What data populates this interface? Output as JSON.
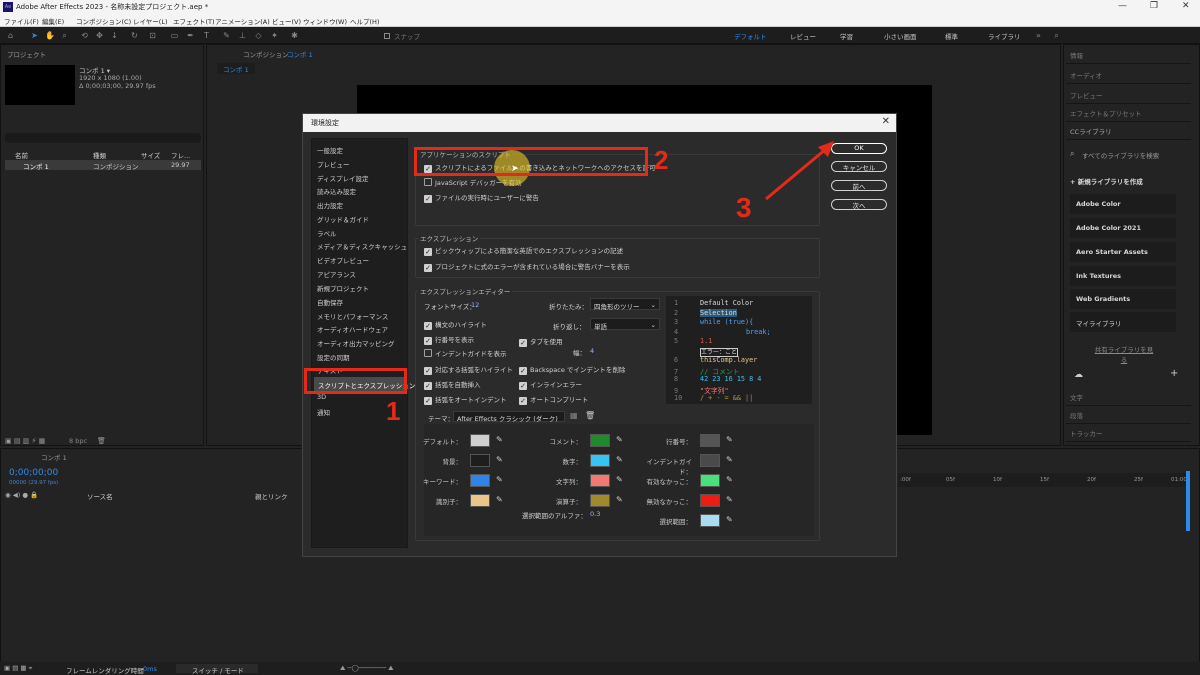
{
  "app": {
    "logo": "Ae",
    "title": "Adobe After Effects 2023 - 名称未設定プロジェクト.aep *",
    "menu": [
      "ファイル(F)",
      "編集(E)",
      "コンポジション(C)",
      "レイヤー(L)",
      "エフェクト(T)",
      "アニメーション(A)",
      "ビュー(V)",
      "ウィンドウ(W)",
      "ヘルプ(H)"
    ],
    "snap_label": "スナップ",
    "workspaces": [
      "デフォルト",
      "レビュー",
      "学習",
      "小さい画面",
      "標準",
      "ライブラリ"
    ],
    "accent": "#2d8ceb"
  },
  "project_panel": {
    "title": "プロジェクト",
    "comp_name": "コンポ 1 ▾",
    "comp_info": [
      "1920 x 1080 (1.00)",
      "Δ 0;00;03;00, 29.97 fps"
    ],
    "columns": [
      "名前",
      "種類",
      "サイズ",
      "フレ..."
    ],
    "rows": [
      {
        "name": "コンポ 1",
        "type": "コンポジション",
        "fps": "29.97"
      }
    ],
    "bpc": "8 bpc"
  },
  "comp_panel": {
    "header": "コンポジション",
    "tab": "コンポ 1",
    "breadcrumb": "コンポ 1"
  },
  "right_panel": {
    "items": [
      "情報",
      "オーディオ",
      "プレビュー",
      "エフェクト＆プリセット"
    ],
    "lib_header": "CCライブラリ",
    "search_placeholder": "すべてのライブラリを検索",
    "new_library": "新規ライブラリを作成",
    "libraries": [
      "Adobe Color",
      "Adobe Color 2021",
      "Aero Starter Assets",
      "Ink Textures",
      "Web Gradients",
      "マイライブラリ"
    ],
    "shared_link": "共有ライブラリを見る",
    "bottom_items": [
      "文字",
      "段落",
      "トラッカー"
    ]
  },
  "timeline": {
    "tab": "コンポ 1",
    "timecode": "0;00;00;00",
    "timecode_sub": "00000 (29.97 fps)",
    "col_source": "ソース名",
    "col_parent": "親とリンク",
    "ruler": [
      ":00f",
      "05f",
      "10f",
      "15f",
      "20f",
      "25f",
      "01:00f"
    ],
    "render_label": "フレームレンダリング時間",
    "render_value": "0ms",
    "switch_mode": "スイッチ / モード"
  },
  "dialog": {
    "title": "環境設定",
    "categories": [
      "一般設定",
      "プレビュー",
      "ディスプレイ設定",
      "読み込み設定",
      "出力設定",
      "グリッド＆ガイド",
      "ラベル",
      "メディア＆ディスクキャッシュ",
      "ビデオプレビュー",
      "アピアランス",
      "新規プロジェクト",
      "自動保存",
      "メモリとパフォーマンス",
      "オーディオハードウェア",
      "オーディオ出力マッピング",
      "設定の同期",
      "テキスト",
      "スクリプトとエクスプレッション",
      "3D",
      "通知"
    ],
    "selected_index": 17,
    "buttons": {
      "ok": "OK",
      "cancel": "キャンセル",
      "prev": "前へ",
      "next": "次へ"
    },
    "scripting": {
      "label": "アプリケーションのスクリプト",
      "options": [
        {
          "text": "スクリプトによるファイルへの書き込みとネットワークへのアクセスを許可",
          "checked": true
        },
        {
          "text": "JavaScript デバッガーを有効",
          "checked": false
        },
        {
          "text": "ファイルの実行時にユーザーに警告",
          "checked": true
        }
      ]
    },
    "expressions": {
      "label": "エクスプレッション",
      "options": [
        {
          "text": "ピックウィップによる簡潔な英語でのエクスプレッションの記述",
          "checked": true
        },
        {
          "text": "プロジェクトに式のエラーが含まれている場合に警告バナーを表示",
          "checked": true
        }
      ]
    },
    "editor": {
      "label": "エクスプレッションエディター",
      "font_size_label": "フォントサイズ：",
      "font_size": "12",
      "fold_label": "折りたたみ：",
      "fold_value": "四角形のツリー",
      "wrap_label": "折り返し：",
      "wrap_value": "単語",
      "use_tab": "タブを使用",
      "width_label": "幅：",
      "width_value": "4",
      "left_opts": [
        {
          "text": "構文のハイライト",
          "checked": true
        },
        {
          "text": "行番号を表示",
          "checked": true
        },
        {
          "text": "インデントガイドを表示",
          "checked": false
        },
        {
          "text": "対応する括弧をハイライト",
          "checked": true
        },
        {
          "text": "括弧を自動挿入",
          "checked": true
        },
        {
          "text": "括弧をオートインデント",
          "checked": true
        }
      ],
      "right_opts": [
        {
          "text": "Backspace でインデントを削除",
          "checked": true
        },
        {
          "text": "インラインエラー",
          "checked": true
        },
        {
          "text": "オートコンプリート",
          "checked": true
        }
      ],
      "code_lines": [
        "Default Color",
        "Selection",
        "while (true){",
        "break;",
        "1.1",
        "エラー：こと",
        "thisComp.layer",
        "// コメント",
        "42 23 16 15 8 4",
        "\"文字列\"",
        "/ + - = && ||"
      ],
      "line_numbers": [
        "1",
        "2",
        "3",
        "4",
        "5",
        "",
        "6",
        "7",
        "8",
        "9",
        "10"
      ]
    },
    "theme": {
      "label": "テーマ：",
      "value": "After Effects クラシック (ダーク)",
      "alpha_label": "選択範囲のアルファ：",
      "alpha_value": "0.3",
      "swatches": [
        {
          "label": "デフォルト：",
          "color": "#cfcfcf"
        },
        {
          "label": "背景：",
          "color": "#1e1e1e"
        },
        {
          "label": "キーワード：",
          "color": "#2f84e6"
        },
        {
          "label": "識別子：",
          "color": "#e9c58c"
        },
        {
          "label": "コメント：",
          "color": "#1f8a2a"
        },
        {
          "label": "数字：",
          "color": "#37c3f3"
        },
        {
          "label": "文字列：",
          "color": "#f07a72"
        },
        {
          "label": "演算子：",
          "color": "#a08a2c"
        },
        {
          "label": "行番号：",
          "color": "#555555"
        },
        {
          "label": "インデントガイド：",
          "color": "#4a4a4a"
        },
        {
          "label": "有効なかっこ：",
          "color": "#47e07a"
        },
        {
          "label": "無効なかっこ：",
          "color": "#ef1c14"
        },
        {
          "label": "選択範囲：",
          "color": "#a7dcf2"
        }
      ]
    }
  },
  "annotations": {
    "n1": "1",
    "n2": "2",
    "n3": "3",
    "color": "#e52a1a"
  }
}
